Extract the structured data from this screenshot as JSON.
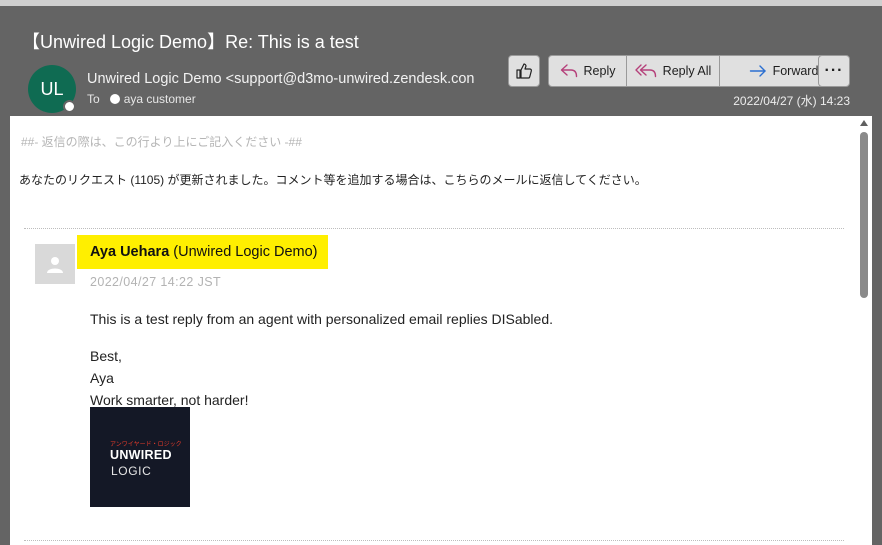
{
  "message": {
    "subject": "【Unwired Logic Demo】Re: This is a test",
    "avatar_initials": "UL",
    "from": "Unwired Logic Demo <support@d3mo-unwired.zendesk.con",
    "to_label": "To",
    "to_name": "aya customer",
    "datetime": "2022/04/27 (水) 14:23"
  },
  "toolbar": {
    "reply": "Reply",
    "reply_all": "Reply All",
    "forward": "Forward",
    "more": "···"
  },
  "body": {
    "reply_marker": "##- 返信の際は、この行より上にご記入ください -##",
    "notice": "あなたのリクエスト (1105) が更新されました。コメント等を追加する場合は、こちらのメールに返信してください。",
    "agent_name": "Aya Uehara",
    "agent_org": "(Unwired Logic Demo)",
    "timestamp": "2022/04/27 14:22 JST",
    "line1": "This is a test reply from an agent with personalized email replies DISabled.",
    "line2": "Best,",
    "line3": "Aya",
    "line4": "Work smarter, not harder!",
    "logo_jp": "アンワイヤード・ロジック",
    "logo_line1": "UNWIRED",
    "logo_line2": "LOGIC"
  },
  "colors": {
    "header_bg": "#646464",
    "avatar_bg": "#0f6b52",
    "highlight": "#ffef00",
    "reply_icon": "#b5407a",
    "forward_icon": "#2b6fd1"
  }
}
